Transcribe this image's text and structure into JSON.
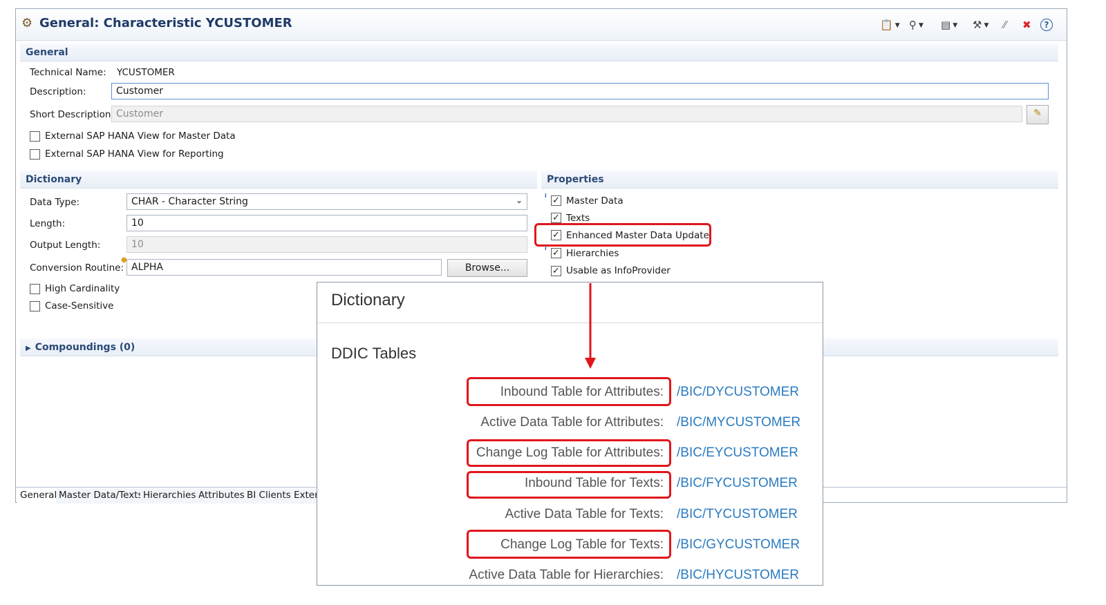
{
  "editor": {
    "title": "General: Characteristic YCUSTOMER",
    "toolbar_icons": [
      "clipboard-icon",
      "search-icon",
      "chart-icon",
      "wrench-icon",
      "link-icon",
      "close-icon",
      "help-icon"
    ]
  },
  "general": {
    "header": "General",
    "technical_name_label": "Technical Name:",
    "technical_name_value": "YCUSTOMER",
    "description_label": "Description:",
    "description_value": "Customer",
    "short_description_label": "Short Description:",
    "short_description_value": "Customer",
    "external_view_master_data": "External SAP HANA View for Master Data",
    "external_view_reporting": "External SAP HANA View for Reporting"
  },
  "dictionary": {
    "header": "Dictionary",
    "data_type_label": "Data Type:",
    "data_type_value": "CHAR - Character String",
    "length_label": "Length:",
    "length_value": "10",
    "output_length_label": "Output Length:",
    "output_length_value": "10",
    "conversion_routine_label": "Conversion Routine:",
    "conversion_routine_value": "ALPHA",
    "browse_label": "Browse...",
    "high_cardinality": "High Cardinality",
    "case_sensitive": "Case-Sensitive"
  },
  "properties": {
    "header": "Properties",
    "master_data": "Master Data",
    "texts": "Texts",
    "enhanced_update": "Enhanced Master Data Update",
    "hierarchies": "Hierarchies",
    "usable_infoprovider": "Usable as InfoProvider"
  },
  "compoundings": {
    "label": "Compoundings (0)"
  },
  "tabs": [
    "General",
    "Master Data/Texts",
    "Hierarchies",
    "Attributes",
    "BI Clients",
    "Exten"
  ],
  "ddic_panel": {
    "title": "Dictionary",
    "subtitle": "DDIC Tables",
    "rows": [
      {
        "label": "Inbound Table for Attributes:",
        "value": "/BIC/DYCUSTOMER"
      },
      {
        "label": "Active Data Table for Attributes:",
        "value": "/BIC/MYCUSTOMER"
      },
      {
        "label": "Change Log Table for Attributes:",
        "value": "/BIC/EYCUSTOMER"
      },
      {
        "label": "Inbound Table for Texts:",
        "value": "/BIC/FYCUSTOMER"
      },
      {
        "label": "Active Data Table for Texts:",
        "value": "/BIC/TYCUSTOMER"
      },
      {
        "label": "Change Log Table for Texts:",
        "value": "/BIC/GYCUSTOMER"
      },
      {
        "label": "Active Data Table for Hierarchies:",
        "value": "/BIC/HYCUSTOMER"
      }
    ]
  },
  "colors": {
    "highlight": "#e0161c",
    "link": "#2a7bc0",
    "section_header": "#2b4a78"
  }
}
